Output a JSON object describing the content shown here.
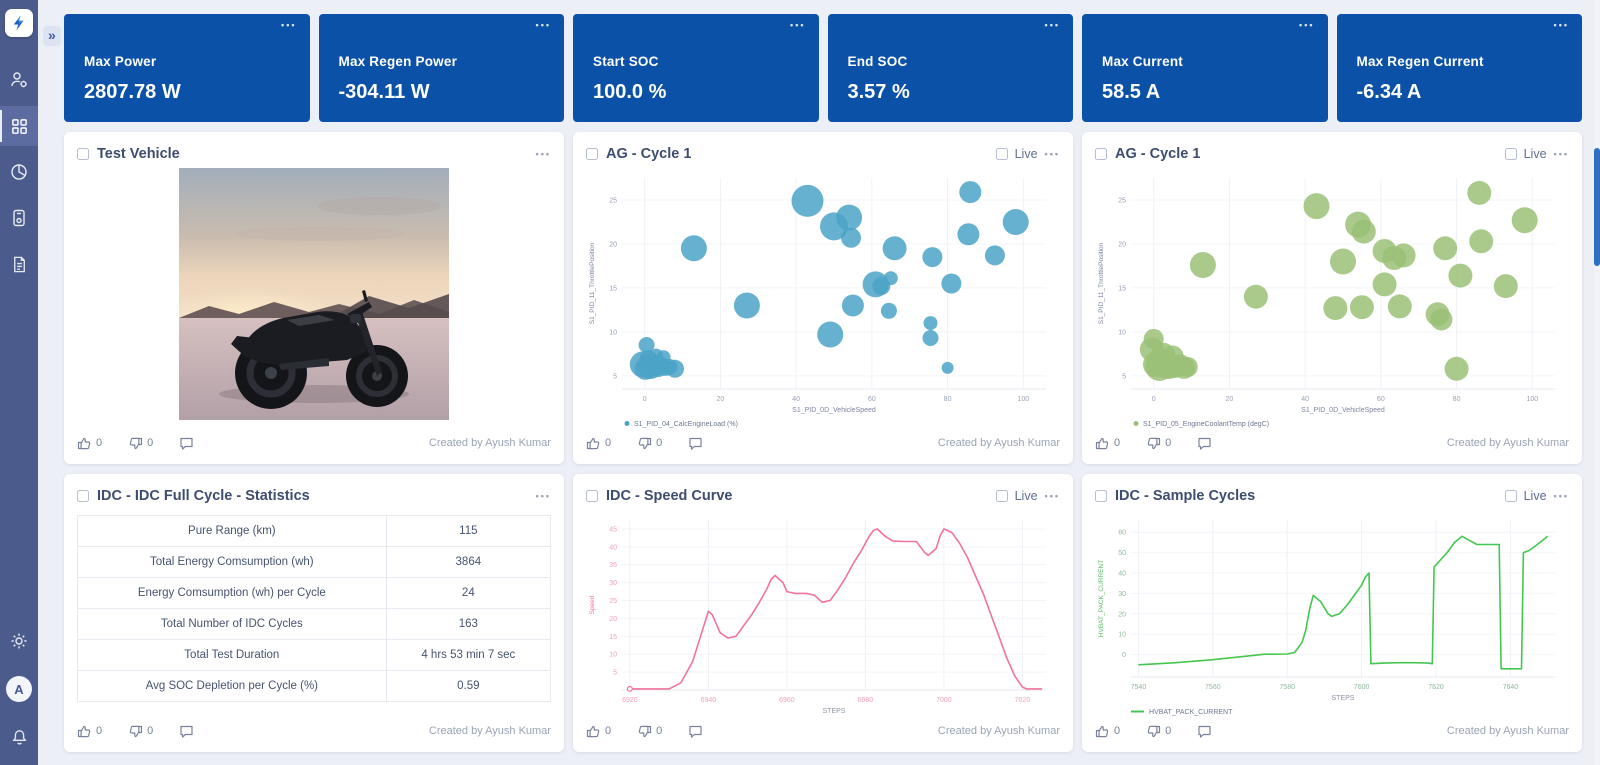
{
  "ui": {
    "dots": "•••",
    "expand_icon": "»",
    "live_label": "Live",
    "avatar_letter": "A"
  },
  "sidebar": {
    "items": [
      {
        "name": "user-management"
      },
      {
        "name": "dashboards",
        "selected": true
      },
      {
        "name": "analytics"
      },
      {
        "name": "device-tests"
      },
      {
        "name": "reports"
      }
    ],
    "bottom": [
      {
        "name": "settings"
      },
      {
        "name": "profile"
      },
      {
        "name": "notifications"
      }
    ]
  },
  "kpis": [
    {
      "label": "Max Power",
      "value": "2807.78 W"
    },
    {
      "label": "Max Regen Power",
      "value": "-304.11 W"
    },
    {
      "label": "Start SOC",
      "value": "100.0 %"
    },
    {
      "label": "End SOC",
      "value": "3.57 %"
    },
    {
      "label": "Max Current",
      "value": "58.5 A"
    },
    {
      "label": "Max Regen Current",
      "value": "-6.34 A"
    }
  ],
  "cards": {
    "vehicle": {
      "title": "Test Vehicle"
    },
    "scatter_blue": {
      "title": "AG - Cycle 1"
    },
    "scatter_green": {
      "title": "AG - Cycle 1"
    },
    "stats": {
      "title": "IDC - IDC Full Cycle - Statistics"
    },
    "speed": {
      "title": "IDC - Speed Curve"
    },
    "cycles": {
      "title": "IDC - Sample Cycles"
    }
  },
  "stats_table": {
    "rows": [
      {
        "label": "Pure Range (km)",
        "value": "115"
      },
      {
        "label": "Total Energy Comsumption (wh)",
        "value": "3864"
      },
      {
        "label": "Energy Comsumption (wh) per Cycle",
        "value": "24"
      },
      {
        "label": "Total Number of IDC Cycles",
        "value": "163"
      },
      {
        "label": "Total Test Duration",
        "value": "4 hrs 53 min 7 sec"
      },
      {
        "label": "Avg SOC Depletion per Cycle (%)",
        "value": "0.59"
      }
    ]
  },
  "footer": {
    "like_count": "0",
    "dislike_count": "0",
    "created_by": "Created by Ayush Kumar"
  },
  "chart_data": [
    {
      "type": "scatter",
      "title": "AG - Cycle 1",
      "xlabel": "S1_PID_0D_VehicleSpeed",
      "ylabel": "S1_PID_11_ThrottlePosition",
      "legend": [
        "S1_PID_04_CalcEngineLoad (%)"
      ],
      "color": "#4ba3c7",
      "tick_color": "#98a1b7",
      "xlabel_color": "#7b86a0",
      "ylabel_color": "#7b86a0",
      "xlim": [
        -6,
        106
      ],
      "ylim": [
        3.5,
        27.5
      ],
      "xticks": [
        0,
        20,
        40,
        60,
        80,
        100
      ],
      "yticks": [
        5,
        10,
        15,
        20,
        25
      ],
      "points": [
        [
          -0.5,
          6.3,
          13
        ],
        [
          0.2,
          5.8,
          11
        ],
        [
          0.5,
          8.5,
          8
        ],
        [
          1,
          6.9,
          9
        ],
        [
          1.6,
          6,
          12
        ],
        [
          2.5,
          6.2,
          11
        ],
        [
          3,
          7.3,
          7
        ],
        [
          3.6,
          6,
          10
        ],
        [
          4.5,
          6.1,
          9
        ],
        [
          5,
          7.1,
          7
        ],
        [
          5.6,
          5.9,
          8
        ],
        [
          6.6,
          6,
          8
        ],
        [
          8,
          5.8,
          9
        ],
        [
          13,
          19.5,
          13
        ],
        [
          27,
          13,
          13
        ],
        [
          43,
          24.9,
          16
        ],
        [
          49,
          9.7,
          13
        ],
        [
          50,
          22,
          14
        ],
        [
          54,
          23,
          13
        ],
        [
          54.5,
          20.7,
          10
        ],
        [
          55,
          13,
          11
        ],
        [
          61,
          15.4,
          13
        ],
        [
          62.5,
          15.2,
          9
        ],
        [
          64.5,
          12.4,
          8
        ],
        [
          65,
          16.1,
          7
        ],
        [
          66,
          19.5,
          12
        ],
        [
          75.5,
          9.3,
          8
        ],
        [
          75.5,
          11,
          7
        ],
        [
          76,
          18.5,
          10
        ],
        [
          80,
          5.9,
          6
        ],
        [
          81,
          15.5,
          10
        ],
        [
          85.5,
          21.1,
          11
        ],
        [
          86,
          25.9,
          11
        ],
        [
          92.5,
          18.7,
          10
        ],
        [
          98,
          22.5,
          13
        ]
      ]
    },
    {
      "type": "scatter",
      "title": "AG - Cycle 1",
      "xlabel": "S1_PID_0D_VehicleSpeed",
      "ylabel": "S1_PID_11_ThrottlePosition",
      "legend": [
        "S1_PID_05_EngineCoolantTemp (degC)"
      ],
      "color": "#9ac177",
      "tick_color": "#98a1b7",
      "xlabel_color": "#7b86a0",
      "ylabel_color": "#7b86a0",
      "xlim": [
        -6,
        106
      ],
      "ylim": [
        3.5,
        27.5
      ],
      "xticks": [
        0,
        20,
        40,
        60,
        80,
        100
      ],
      "yticks": [
        5,
        10,
        15,
        20,
        25
      ],
      "points": [
        [
          -0.5,
          8,
          12
        ],
        [
          0,
          9.2,
          10
        ],
        [
          0.6,
          6.3,
          13
        ],
        [
          1.5,
          6,
          14
        ],
        [
          2.5,
          7.4,
          12
        ],
        [
          3.2,
          6.2,
          13
        ],
        [
          4,
          6,
          12
        ],
        [
          5,
          7.2,
          11
        ],
        [
          5.6,
          6,
          11
        ],
        [
          7,
          6.2,
          11
        ],
        [
          8,
          5.9,
          11
        ],
        [
          9,
          6,
          10
        ],
        [
          13,
          17.6,
          13
        ],
        [
          27,
          14,
          12
        ],
        [
          43,
          24.3,
          13
        ],
        [
          48,
          12.7,
          12
        ],
        [
          50,
          18,
          13
        ],
        [
          54,
          22.2,
          13
        ],
        [
          55.5,
          21.4,
          12
        ],
        [
          55,
          12.8,
          12
        ],
        [
          61,
          19.2,
          12
        ],
        [
          61,
          15.4,
          12
        ],
        [
          63.5,
          18.4,
          12
        ],
        [
          65,
          12.9,
          12
        ],
        [
          66,
          18.7,
          12
        ],
        [
          75,
          12,
          12
        ],
        [
          76,
          11.4,
          11
        ],
        [
          77,
          19.5,
          12
        ],
        [
          80,
          5.8,
          12
        ],
        [
          81,
          16.4,
          12
        ],
        [
          86,
          25.8,
          12
        ],
        [
          86.5,
          20.3,
          12
        ],
        [
          93,
          15.2,
          12
        ],
        [
          98,
          22.7,
          13
        ]
      ]
    },
    {
      "type": "line",
      "title": "IDC - Speed Curve",
      "xlabel": "STEPS",
      "ylabel": "Speed",
      "legend": [],
      "color": "#f2729f",
      "tick_color": "#f0a0bd",
      "xlabel_color": "#8d93a5",
      "ylabel_color": "#f2729f",
      "start_marker": true,
      "xlim": [
        6918,
        7026
      ],
      "ylim": [
        0,
        47.5
      ],
      "xticks": [
        6920,
        6940,
        6960,
        6980,
        7000,
        7020
      ],
      "yticks": [
        5,
        10,
        15,
        20,
        25,
        30,
        35,
        40,
        45
      ],
      "points": [
        [
          6920,
          0.3
        ],
        [
          6930,
          0.3
        ],
        [
          6933,
          2
        ],
        [
          6936,
          8
        ],
        [
          6938,
          15
        ],
        [
          6940,
          22
        ],
        [
          6941,
          21
        ],
        [
          6943,
          16
        ],
        [
          6945,
          14.5
        ],
        [
          6947,
          15
        ],
        [
          6949,
          18
        ],
        [
          6951,
          21
        ],
        [
          6953,
          24.5
        ],
        [
          6955,
          28.5
        ],
        [
          6956,
          31
        ],
        [
          6957,
          32
        ],
        [
          6959,
          30
        ],
        [
          6960,
          27.5
        ],
        [
          6962,
          27
        ],
        [
          6965,
          27
        ],
        [
          6967,
          26.5
        ],
        [
          6969,
          24.5
        ],
        [
          6971,
          25
        ],
        [
          6973,
          28
        ],
        [
          6975,
          31.5
        ],
        [
          6977,
          35.5
        ],
        [
          6979,
          39
        ],
        [
          6980,
          41
        ],
        [
          6981,
          43
        ],
        [
          6982,
          44.5
        ],
        [
          6983,
          45
        ],
        [
          6985,
          43
        ],
        [
          6987,
          41.6
        ],
        [
          6990,
          41.5
        ],
        [
          6993,
          41.5
        ],
        [
          6995,
          38.5
        ],
        [
          6996,
          37.6
        ],
        [
          6998,
          39.5
        ],
        [
          6999,
          43
        ],
        [
          7000,
          45
        ],
        [
          7002,
          44
        ],
        [
          7004,
          41
        ],
        [
          7006,
          37
        ],
        [
          7008,
          32
        ],
        [
          7010,
          27
        ],
        [
          7012,
          21
        ],
        [
          7014,
          15
        ],
        [
          7016,
          9
        ],
        [
          7018,
          4
        ],
        [
          7020,
          0.8
        ],
        [
          7021,
          0.3
        ],
        [
          7025,
          0.3
        ]
      ]
    },
    {
      "type": "line",
      "title": "IDC - Sample Cycles",
      "xlabel": "STEPS",
      "ylabel": "HVBAT_PACK_CURRENT",
      "legend": [
        "HVBAT_PACK_CURRENT"
      ],
      "color": "#44c74f",
      "tick_color": "#8fb89a",
      "xlabel_color": "#8d93a5",
      "ylabel_color": "#5abf66",
      "xlim": [
        7538,
        7652
      ],
      "ylim": [
        -11,
        66
      ],
      "xticks": [
        7540,
        7560,
        7580,
        7600,
        7620,
        7640
      ],
      "yticks": [
        0,
        10,
        20,
        30,
        40,
        50,
        60
      ],
      "points": [
        [
          7540,
          -5
        ],
        [
          7550,
          -4
        ],
        [
          7560,
          -2.5
        ],
        [
          7568,
          -1
        ],
        [
          7574,
          0.2
        ],
        [
          7580,
          0.3
        ],
        [
          7582,
          1
        ],
        [
          7584,
          6
        ],
        [
          7585,
          12
        ],
        [
          7586,
          22
        ],
        [
          7587,
          29
        ],
        [
          7589,
          26
        ],
        [
          7591,
          20
        ],
        [
          7592,
          18.7
        ],
        [
          7594,
          20
        ],
        [
          7596,
          24
        ],
        [
          7598,
          29
        ],
        [
          7600,
          34
        ],
        [
          7601,
          38
        ],
        [
          7602,
          40
        ],
        [
          7602.5,
          -4.5
        ],
        [
          7606,
          -4.2
        ],
        [
          7610,
          -4
        ],
        [
          7614,
          -4
        ],
        [
          7618,
          -4.2
        ],
        [
          7619,
          -4.5
        ],
        [
          7619.5,
          43
        ],
        [
          7621,
          46
        ],
        [
          7623,
          50
        ],
        [
          7625,
          55
        ],
        [
          7627,
          58
        ],
        [
          7629,
          56
        ],
        [
          7631,
          54
        ],
        [
          7634,
          54
        ],
        [
          7637,
          54
        ],
        [
          7637.5,
          -7
        ],
        [
          7640,
          -7
        ],
        [
          7643,
          -7
        ],
        [
          7643.5,
          50
        ],
        [
          7645,
          51
        ],
        [
          7648,
          55
        ],
        [
          7650,
          58
        ]
      ]
    }
  ]
}
